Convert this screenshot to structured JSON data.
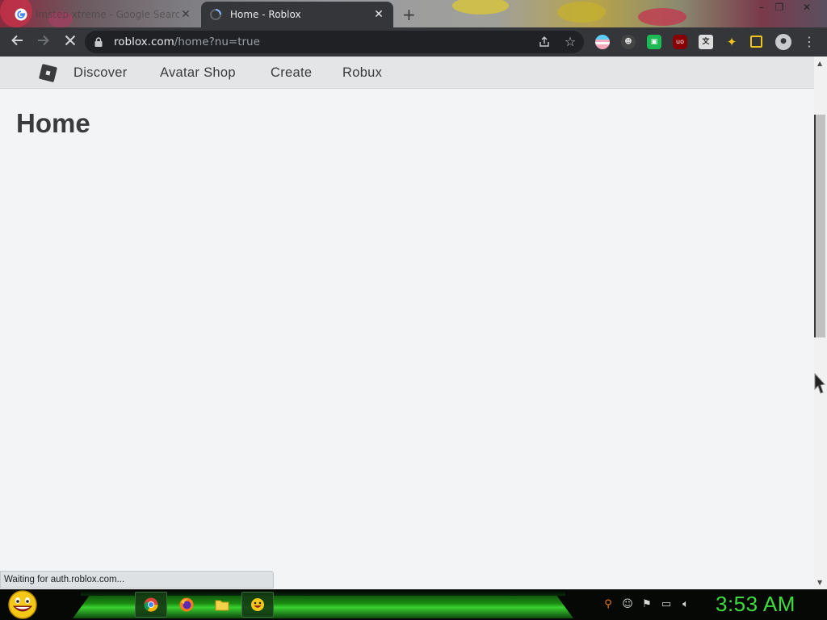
{
  "browser": {
    "tabs": [
      {
        "label": "imstep xtreme - Google Search",
        "favicon": "google-icon",
        "active": false
      },
      {
        "label": "Home - Roblox",
        "favicon": "loading-spinner-icon",
        "active": true
      }
    ],
    "new_tab_symbol": "+",
    "window_controls": {
      "minimize": "–",
      "restore": "❐",
      "close": "✕"
    },
    "url": {
      "host": "roblox.com",
      "path": "/home?nu=true"
    },
    "status_text": "Waiting for auth.roblox.com..."
  },
  "site": {
    "nav": {
      "items": [
        "Discover",
        "Avatar Shop",
        "Create",
        "Robux"
      ]
    },
    "page_title": "Home"
  },
  "taskbar": {
    "pinned": [
      "chrome-icon",
      "firefox-icon",
      "file-explorer-icon",
      "smiley-icon"
    ],
    "clock": "3:53 AM"
  },
  "colors": {
    "toolbar_bg": "#35363a",
    "nav_bg": "#e3e5e7",
    "page_bg": "#f2f4f5",
    "clock": "#3cdd3c"
  }
}
